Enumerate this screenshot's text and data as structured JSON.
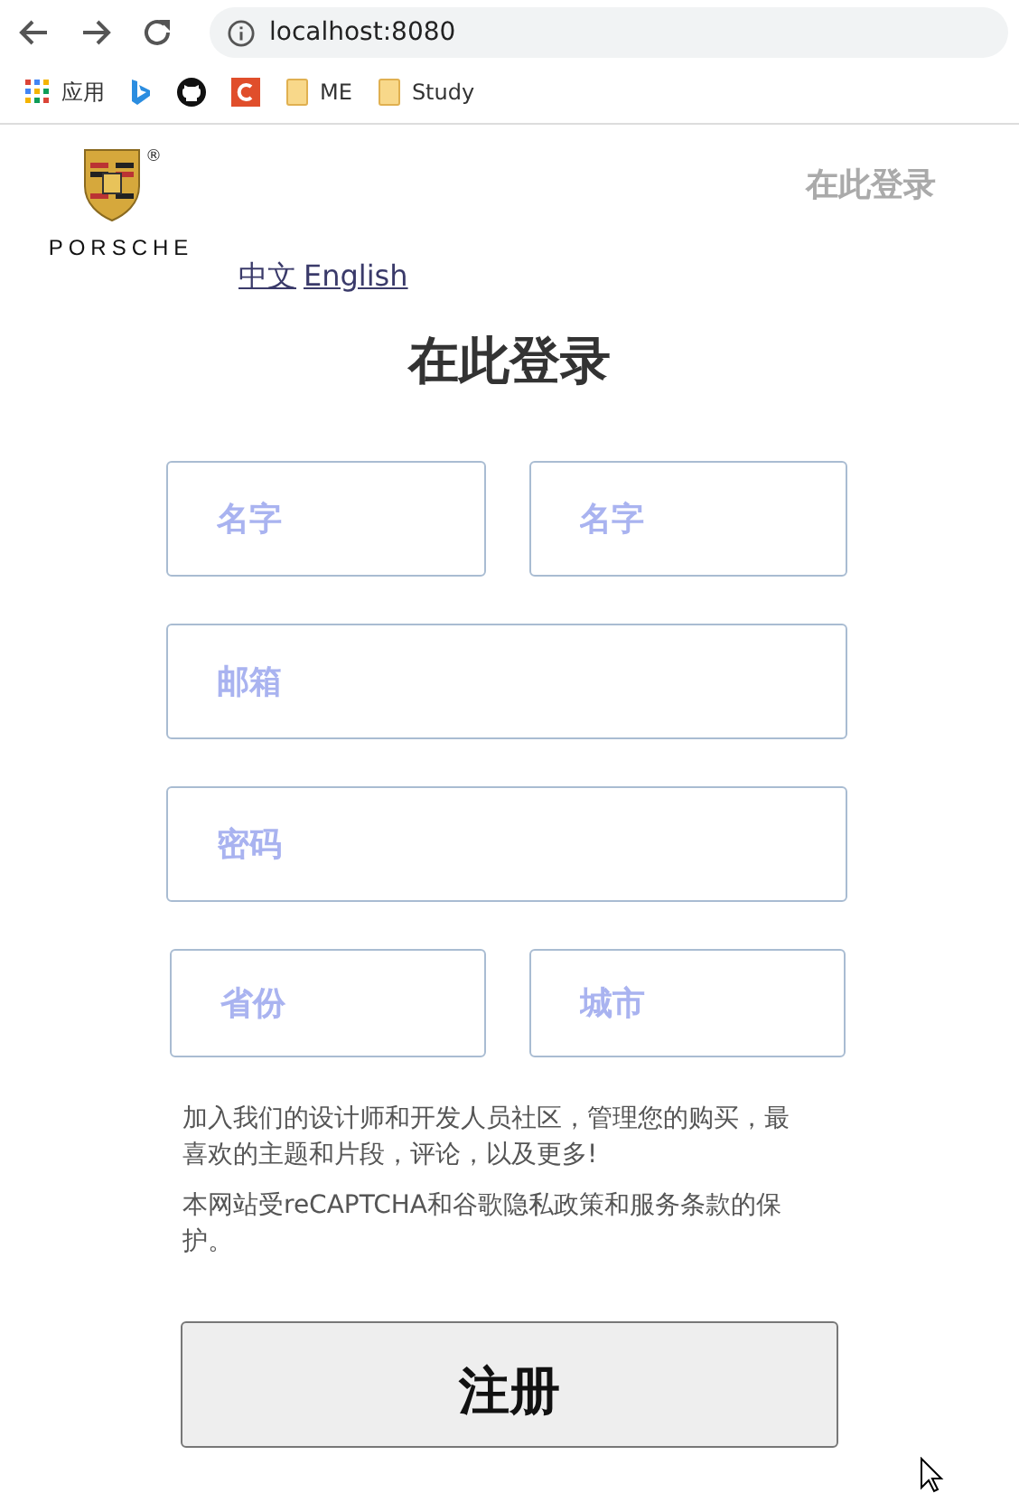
{
  "browser": {
    "url": "localhost:8080",
    "bookmarks": [
      {
        "kind": "apps",
        "label": "应用"
      },
      {
        "kind": "bing"
      },
      {
        "kind": "github"
      },
      {
        "kind": "c"
      },
      {
        "kind": "folder",
        "label": "ME"
      },
      {
        "kind": "folder",
        "label": "Study"
      }
    ]
  },
  "header": {
    "logo_text": "PORSCHE",
    "logo_mark": "®",
    "nav_link": "在此登录",
    "languages": [
      "中文",
      "English"
    ]
  },
  "form": {
    "title": "在此登录",
    "rows": [
      [
        {
          "placeholder": "名字"
        },
        {
          "placeholder": "名字"
        }
      ],
      [
        {
          "placeholder": "邮箱"
        }
      ],
      [
        {
          "placeholder": "密码"
        }
      ],
      [
        {
          "placeholder": "省份"
        },
        {
          "placeholder": "城市"
        }
      ]
    ],
    "paragraphs": [
      "加入我们的设计师和开发人员社区，管理您的购买，最喜欢的主题和片段，评论，以及更多!",
      "本网站受reCAPTCHA和谷歌隐私政策和服务条款的保护。"
    ],
    "submit": "注册"
  }
}
